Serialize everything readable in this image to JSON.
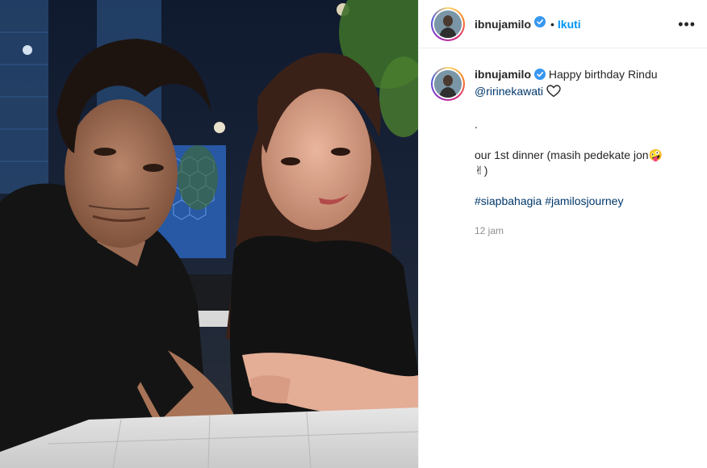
{
  "post": {
    "username": "ibnujamilo",
    "follow_label": "Ikuti",
    "separator": "•",
    "more_label": "•••"
  },
  "caption": {
    "username": "ibnujamilo",
    "line1": "Happy birthday Rindu",
    "mention": "@ririnekawati",
    "dot_line": ".",
    "line2": "our 1st dinner (masih pedekate jon",
    "emoji_face": "🤪",
    "emoji_hand": "✌",
    "line2_close": ")",
    "hashtag1": "#siapbahagia",
    "hashtag2": "#jamilosjourney",
    "time": "12 jam"
  },
  "colors": {
    "link_blue": "#0095f6",
    "hashtag_blue": "#00376b",
    "muted_gray": "#8e8e8e",
    "verified_blue": "#3897f0"
  }
}
